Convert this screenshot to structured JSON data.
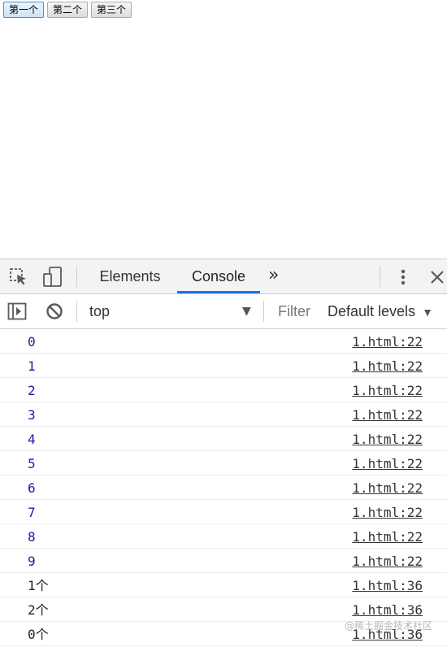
{
  "page": {
    "buttons": [
      "第一个",
      "第二个",
      "第三个"
    ]
  },
  "devtools": {
    "tabs": {
      "elements": "Elements",
      "console": "Console",
      "more": "»"
    },
    "icons": {
      "inspect": "inspect-element-icon",
      "device": "device-toolbar-icon",
      "kebab": "more-options-icon",
      "close": "close-icon",
      "sidebar": "show-sidebar-icon",
      "clear": "clear-console-icon"
    },
    "console_toolbar": {
      "context": "top",
      "context_caret": "▼",
      "filter_placeholder": "Filter",
      "levels": "Default levels",
      "levels_caret": "▼"
    },
    "messages": [
      {
        "text": "0",
        "kind": "number",
        "source": "1.html:22"
      },
      {
        "text": "1",
        "kind": "number",
        "source": "1.html:22"
      },
      {
        "text": "2",
        "kind": "number",
        "source": "1.html:22"
      },
      {
        "text": "3",
        "kind": "number",
        "source": "1.html:22"
      },
      {
        "text": "4",
        "kind": "number",
        "source": "1.html:22"
      },
      {
        "text": "5",
        "kind": "number",
        "source": "1.html:22"
      },
      {
        "text": "6",
        "kind": "number",
        "source": "1.html:22"
      },
      {
        "text": "7",
        "kind": "number",
        "source": "1.html:22"
      },
      {
        "text": "8",
        "kind": "number",
        "source": "1.html:22"
      },
      {
        "text": "9",
        "kind": "number",
        "source": "1.html:22"
      },
      {
        "text": "1个",
        "kind": "string",
        "source": "1.html:36"
      },
      {
        "text": "2个",
        "kind": "string",
        "source": "1.html:36"
      },
      {
        "text": "0个",
        "kind": "string",
        "source": "1.html:36"
      }
    ]
  },
  "watermark": "@稀土掘金技术社区",
  "colors": {
    "accent": "#1a73e8",
    "number_text": "#1a1aa6"
  }
}
